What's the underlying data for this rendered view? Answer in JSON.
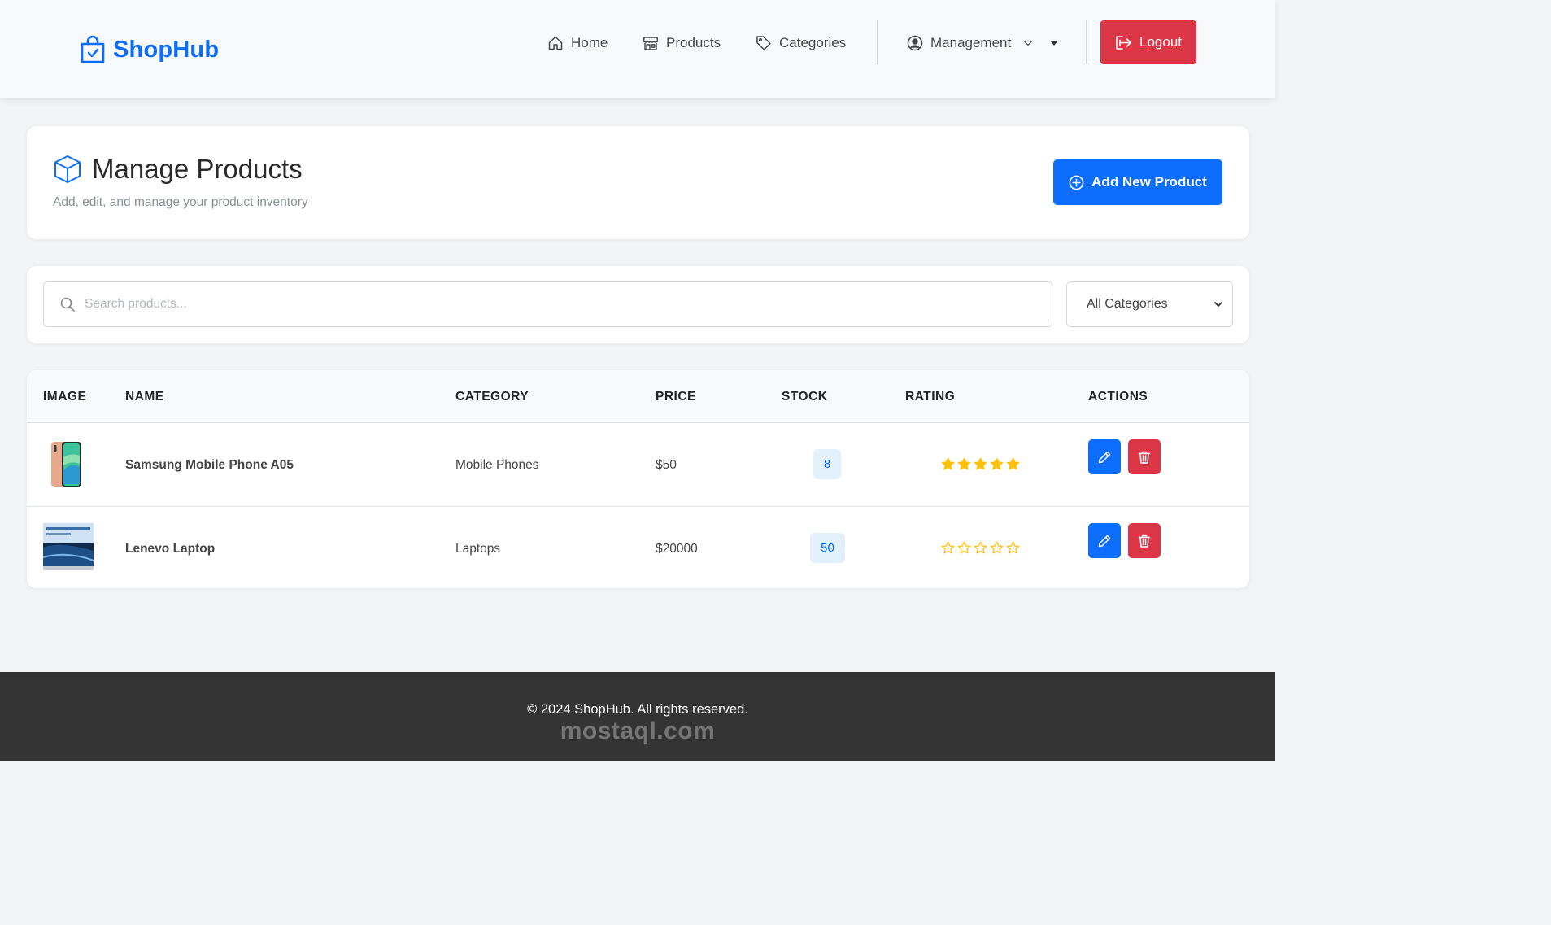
{
  "navbar": {
    "brand": "ShopHub",
    "links": {
      "home": "Home",
      "products": "Products",
      "categories": "Categories",
      "management": "Management"
    },
    "logout": "Logout"
  },
  "header": {
    "title": "Manage Products",
    "subtitle": "Add, edit, and manage your product inventory",
    "add_button": "Add New Product"
  },
  "filters": {
    "search_placeholder": "Search products...",
    "category_selected": "All Categories"
  },
  "table": {
    "columns": {
      "image": "IMAGE",
      "name": "NAME",
      "category": "CATEGORY",
      "price": "PRICE",
      "stock": "STOCK",
      "rating": "RATING",
      "actions": "ACTIONS"
    },
    "rows": [
      {
        "image": "mobile-phone-thumbnail",
        "name": "Samsung Mobile Phone A05",
        "category": "Mobile Phones",
        "price": "$50",
        "stock": "8",
        "rating": 5
      },
      {
        "image": "laptop-thumbnail",
        "name": "Lenevo Laptop",
        "category": "Laptops",
        "price": "$20000",
        "stock": "50",
        "rating": 0
      }
    ]
  },
  "footer": {
    "copyright": "© 2024 ShopHub. All rights reserved.",
    "watermark": "mostaql.com"
  },
  "colors": {
    "primary": "#0d6efd",
    "danger": "#dc3545",
    "star": "#ffc107",
    "footer_bg": "#343434",
    "page_bg": "#f3f4f6"
  }
}
